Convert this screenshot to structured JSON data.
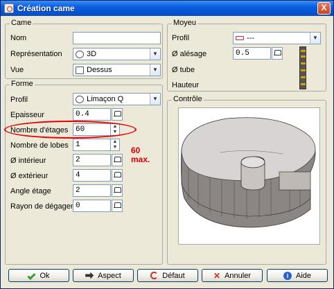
{
  "window": {
    "title": "Création came",
    "close_label": "X"
  },
  "came": {
    "group_label": "Came",
    "nom_label": "Nom",
    "nom_value": "",
    "representation_label": "Représentation",
    "representation_value": "3D",
    "representation_icon": "3d-icon",
    "vue_label": "Vue",
    "vue_value": "Dessus",
    "vue_icon": "top-view-icon"
  },
  "moyeu": {
    "group_label": "Moyeu",
    "profil_label": "Profil",
    "profil_value": "---",
    "profil_icon": "hub-profile-icon",
    "alesage_label": "Ø alésage",
    "alesage_value": "0.5",
    "tube_label": "Ø tube",
    "hauteur_label": "Hauteur"
  },
  "forme": {
    "group_label": "Forme",
    "profil_label": "Profil",
    "profil_value": "Limaçon Q",
    "epaisseur_label": "Epaisseur",
    "epaisseur_value": "0.4",
    "etages_label": "Nombre d'étages",
    "etages_value": "60",
    "lobes_label": "Nombre de lobes",
    "lobes_value": "1",
    "interieur_label": "Ø intérieur",
    "interieur_value": "2",
    "exterieur_label": "Ø extérieur",
    "exterieur_value": "4",
    "angle_label": "Angle étage",
    "angle_value": "2",
    "rayon_label": "Rayon de dégagem",
    "rayon_value": "0"
  },
  "annotation": {
    "line1": "60",
    "line2": "max.",
    "color": "#e00000"
  },
  "controle": {
    "group_label": "Contrôle"
  },
  "buttons": {
    "ok": "Ok",
    "aspect": "Aspect",
    "defaut": "Défaut",
    "annuler": "Annuler",
    "aide": "Aide"
  }
}
